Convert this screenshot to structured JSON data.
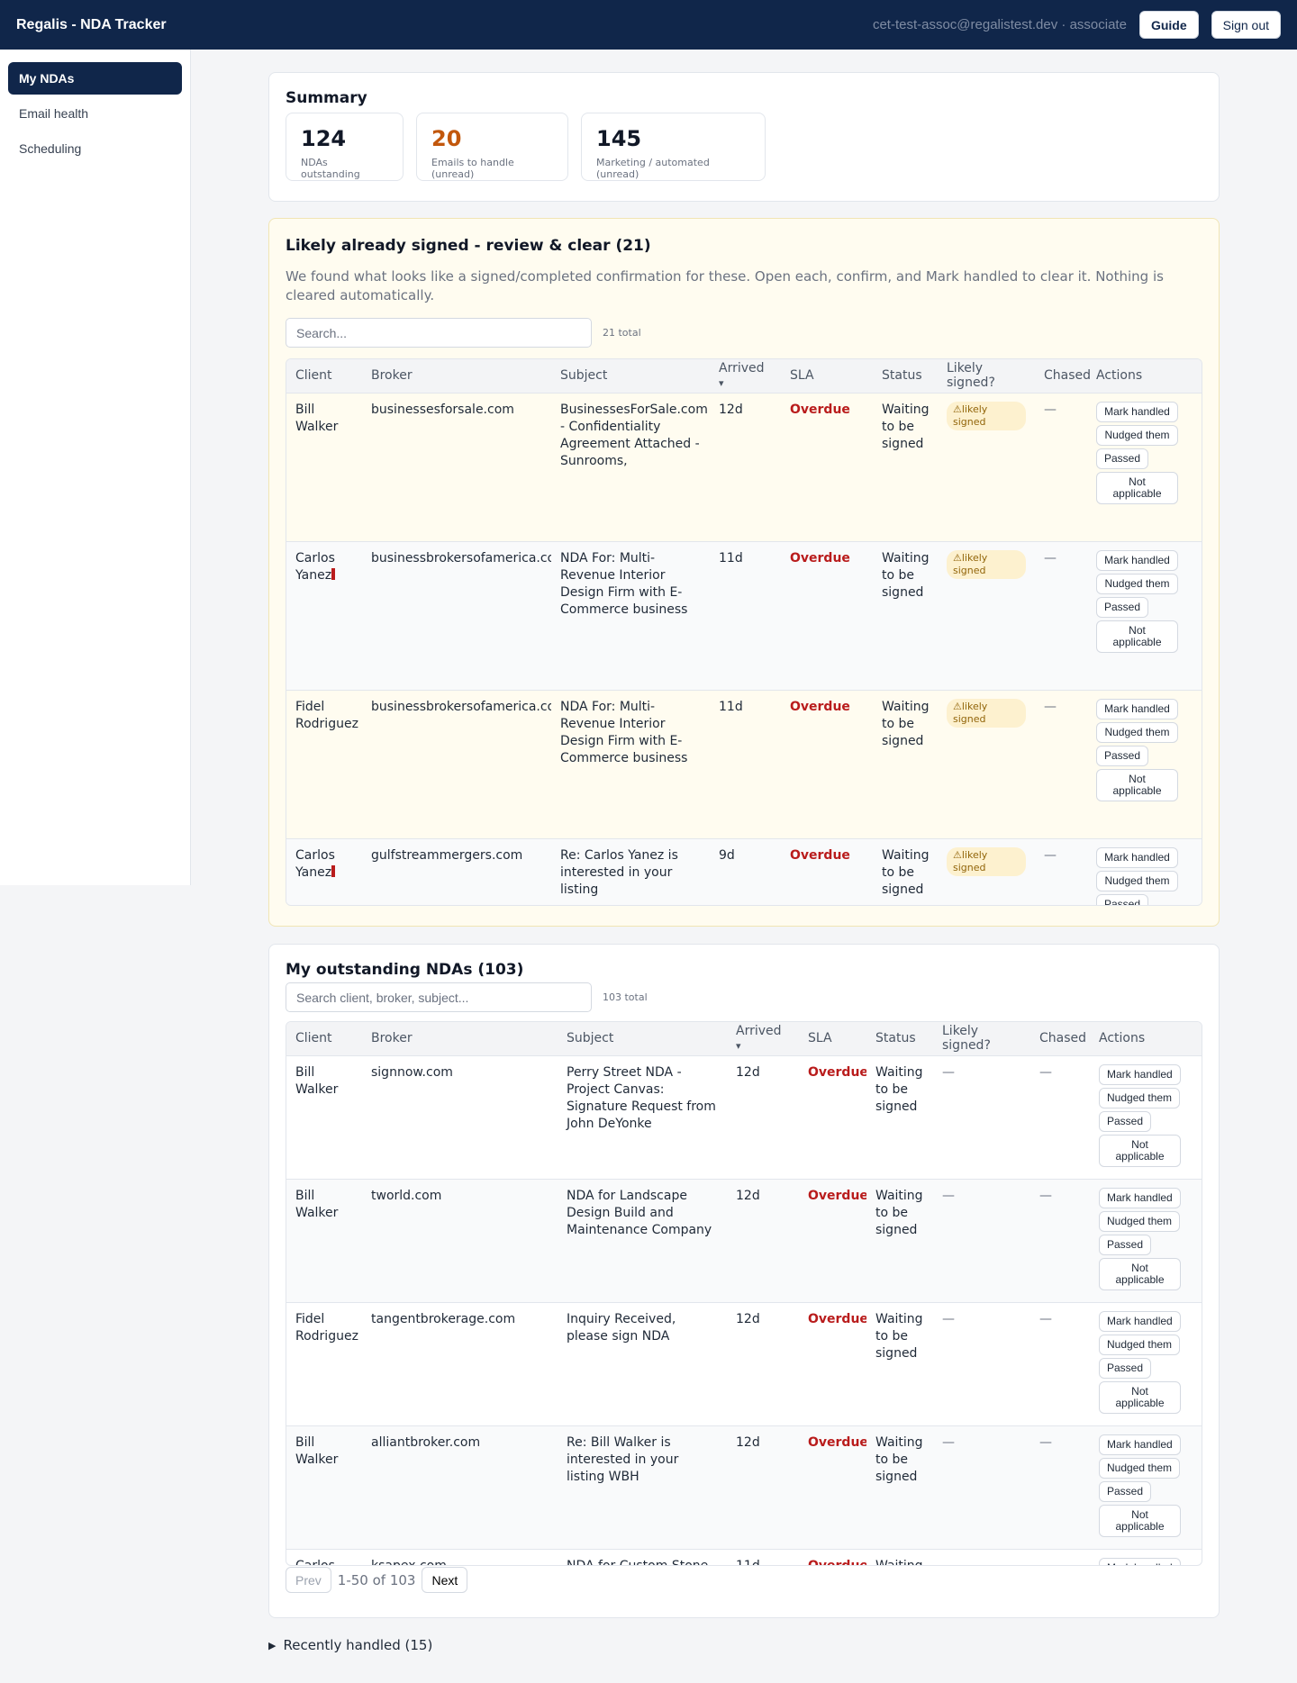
{
  "app": {
    "title": "Regalis - NDA Tracker"
  },
  "user": {
    "email": "cet-test-assoc@regalistest.dev · associate"
  },
  "topbar": {
    "guide": "Guide",
    "signout": "Sign out"
  },
  "nav": [
    {
      "label": "My NDAs"
    },
    {
      "label": "Email health"
    },
    {
      "label": "Scheduling"
    }
  ],
  "summary": {
    "title": "Summary",
    "stats": [
      {
        "value": "124",
        "label": "NDAs outstanding"
      },
      {
        "value": "20",
        "label": "Emails to handle (unread)"
      },
      {
        "value": "145",
        "label": "Marketing / automated (unread)"
      }
    ]
  },
  "colors": {
    "navy": "#10264a",
    "overdue": "#b91c1c",
    "orange": "#c2570c",
    "chip": "#fdf1cf"
  },
  "likely": {
    "title": "Likely already signed - review & clear (21)",
    "intro": "We found what looks like a signed/completed confirmation for these. Open each, confirm, and Mark handled to clear it. Nothing is cleared automatically.",
    "search_placeholder": "Search...",
    "total": "21 total",
    "headers": [
      "Client",
      "Broker",
      "Subject",
      "Arrived",
      "SLA",
      "Status",
      "Likely signed?",
      "Chased",
      "Actions"
    ],
    "sort_icon": "▾",
    "chip": "likely signed",
    "chip_icon": "⚠",
    "rows": [
      {
        "client": "Bill Walker",
        "broker": "businessesforsale.com",
        "subject": "BusinessesForSale.com - Confidentiality Agreement Attached - Sunrooms,",
        "arrived": "12d",
        "sla": "Overdue",
        "status": "Waiting to be signed",
        "chased": "—"
      },
      {
        "client": "Carlos Yanez",
        "broker": "businessbrokersofamerica.com",
        "subject": "NDA For: Multi-Revenue Interior Design Firm with E-Commerce business",
        "arrived": "11d",
        "sla": "Overdue",
        "status": "Waiting to be signed",
        "chased": "—"
      },
      {
        "client": "Fidel Rodriguez",
        "broker": "businessbrokersofamerica.com",
        "subject": "NDA For: Multi-Revenue Interior Design Firm with E-Commerce business",
        "arrived": "11d",
        "sla": "Overdue",
        "status": "Waiting to be signed",
        "chased": "—"
      },
      {
        "client": "Carlos Yanez",
        "broker": "gulfstreammergers.com",
        "subject": "Re: Carlos Yanez is interested in your listing",
        "arrived": "9d",
        "sla": "Overdue",
        "status": "Waiting to be signed",
        "chased": "—"
      }
    ]
  },
  "actions": {
    "mark": "Mark handled",
    "nudged": "Nudged them",
    "passed": "Passed",
    "na": "Not applicable"
  },
  "outstanding": {
    "title": "My outstanding NDAs (103)",
    "search_placeholder": "Search client, broker, subject...",
    "total": "103 total",
    "headers": [
      "Client",
      "Broker",
      "Subject",
      "Arrived",
      "SLA",
      "Status",
      "Likely signed?",
      "Chased",
      "Actions"
    ],
    "rows": [
      {
        "client": "Bill Walker",
        "broker": "signnow.com",
        "subject": "Perry Street NDA - Project Canvas: Signature Request from John DeYonke",
        "arrived": "12d",
        "sla": "Overdue",
        "status": "Waiting to be signed",
        "likely": "—",
        "chased": "—"
      },
      {
        "client": "Bill Walker",
        "broker": "tworld.com",
        "subject": "NDA for Landscape Design Build and Maintenance Company",
        "arrived": "12d",
        "sla": "Overdue",
        "status": "Waiting to be signed",
        "likely": "—",
        "chased": "—"
      },
      {
        "client": "Fidel Rodriguez",
        "broker": "tangentbrokerage.com",
        "subject": "Inquiry Received, please sign NDA",
        "arrived": "12d",
        "sla": "Overdue",
        "status": "Waiting to be signed",
        "likely": "—",
        "chased": "—"
      },
      {
        "client": "Bill Walker",
        "broker": "alliantbroker.com",
        "subject": "Re: Bill Walker is interested in your listing WBH",
        "arrived": "12d",
        "sla": "Overdue",
        "status": "Waiting to be signed",
        "likely": "—",
        "chased": "—"
      },
      {
        "client": "Carlos Yanez",
        "broker": "ksapex.com",
        "subject": "NDA for Custom Stone",
        "arrived": "11d",
        "sla": "Overdue",
        "status": "Waiting",
        "likely": "—",
        "chased": "—"
      }
    ],
    "pager": {
      "prev": "Prev",
      "info": "1-50 of 103",
      "next": "Next"
    }
  },
  "recent": {
    "label": "Recently handled (15)",
    "icon": "▶"
  }
}
